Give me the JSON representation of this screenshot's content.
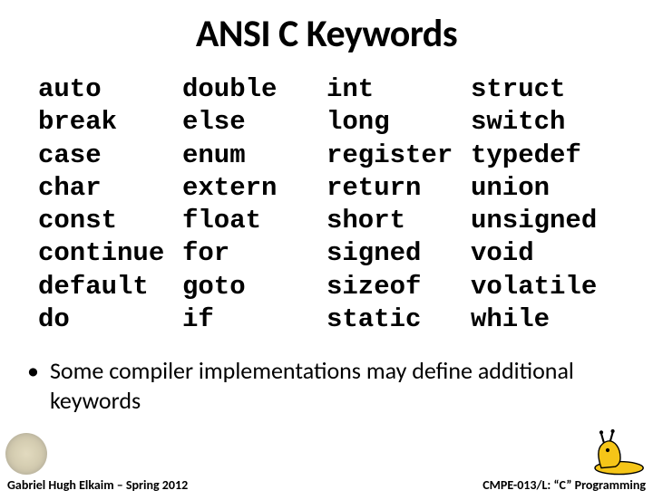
{
  "title": "ANSI C Keywords",
  "columns": {
    "c0": [
      "auto",
      "break",
      "case",
      "char",
      "const",
      "continue",
      "default",
      "do"
    ],
    "c1": [
      "double",
      "else",
      "enum",
      "extern",
      "float",
      "for",
      "goto",
      "if"
    ],
    "c2": [
      "int",
      "long",
      "register",
      "return",
      "short",
      "signed",
      "sizeof",
      "static"
    ],
    "c3": [
      "struct",
      "switch",
      "typedef",
      "union",
      "unsigned",
      "void",
      "volatile",
      "while"
    ]
  },
  "bullet": "Some compiler implementations may define additional keywords",
  "footer_left": "Gabriel Hugh Elkaim – Spring 2012",
  "footer_right": "CMPE-013/L: “C” Programming"
}
